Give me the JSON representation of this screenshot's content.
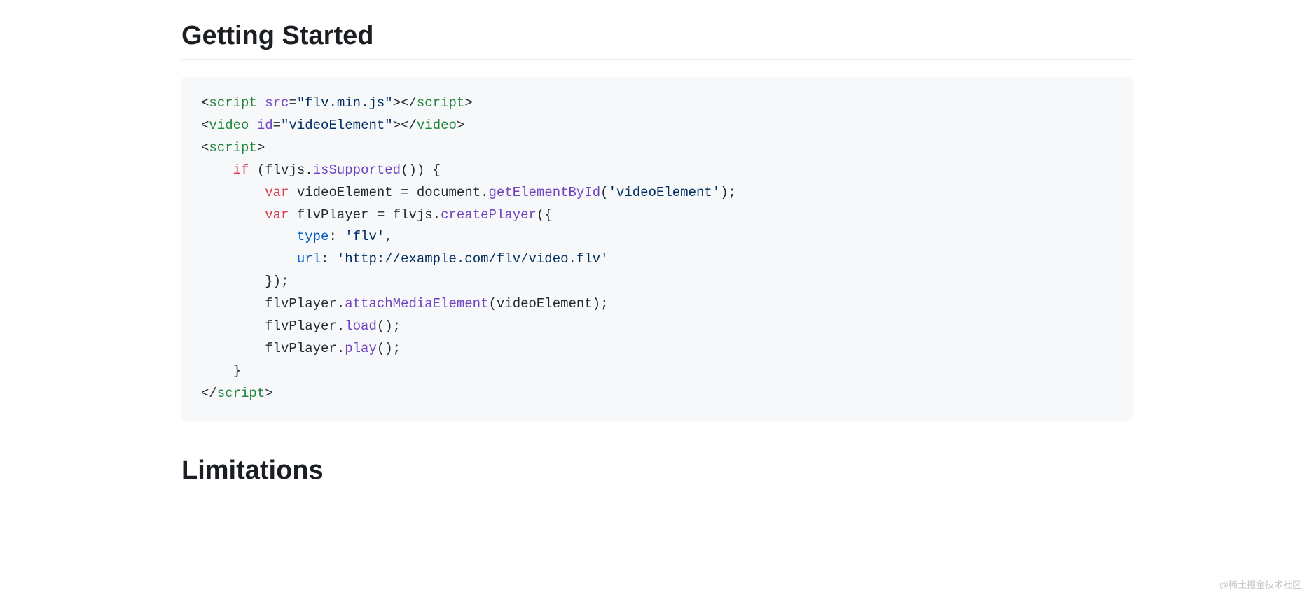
{
  "headings": {
    "getting_started": "Getting Started",
    "limitations": "Limitations"
  },
  "watermark": "@稀土掘金技术社区",
  "code": {
    "line1_tag_open": "script",
    "line1_attr": "src",
    "line1_val": "\"flv.min.js\"",
    "line1_tag_close": "script",
    "line2_tag_open": "video",
    "line2_attr": "id",
    "line2_val": "\"videoElement\"",
    "line2_tag_close": "video",
    "line3_tag": "script",
    "line4_kw": "if",
    "line4_obj": "flvjs",
    "line4_call": "isSupported",
    "line5_kw": "var",
    "line5_var": "videoElement",
    "line5_obj": "document",
    "line5_call": "getElementById",
    "line5_arg": "'videoElement'",
    "line6_kw": "var",
    "line6_var": "flvPlayer",
    "line6_obj": "flvjs",
    "line6_call": "createPlayer",
    "line7_prop": "type",
    "line7_val": "'flv'",
    "line8_prop": "url",
    "line8_val": "'http://example.com/flv/video.flv'",
    "line10_obj": "flvPlayer",
    "line10_call": "attachMediaElement",
    "line10_arg": "videoElement",
    "line11_obj": "flvPlayer",
    "line11_call": "load",
    "line12_obj": "flvPlayer",
    "line12_call": "play",
    "line14_tag": "script"
  }
}
